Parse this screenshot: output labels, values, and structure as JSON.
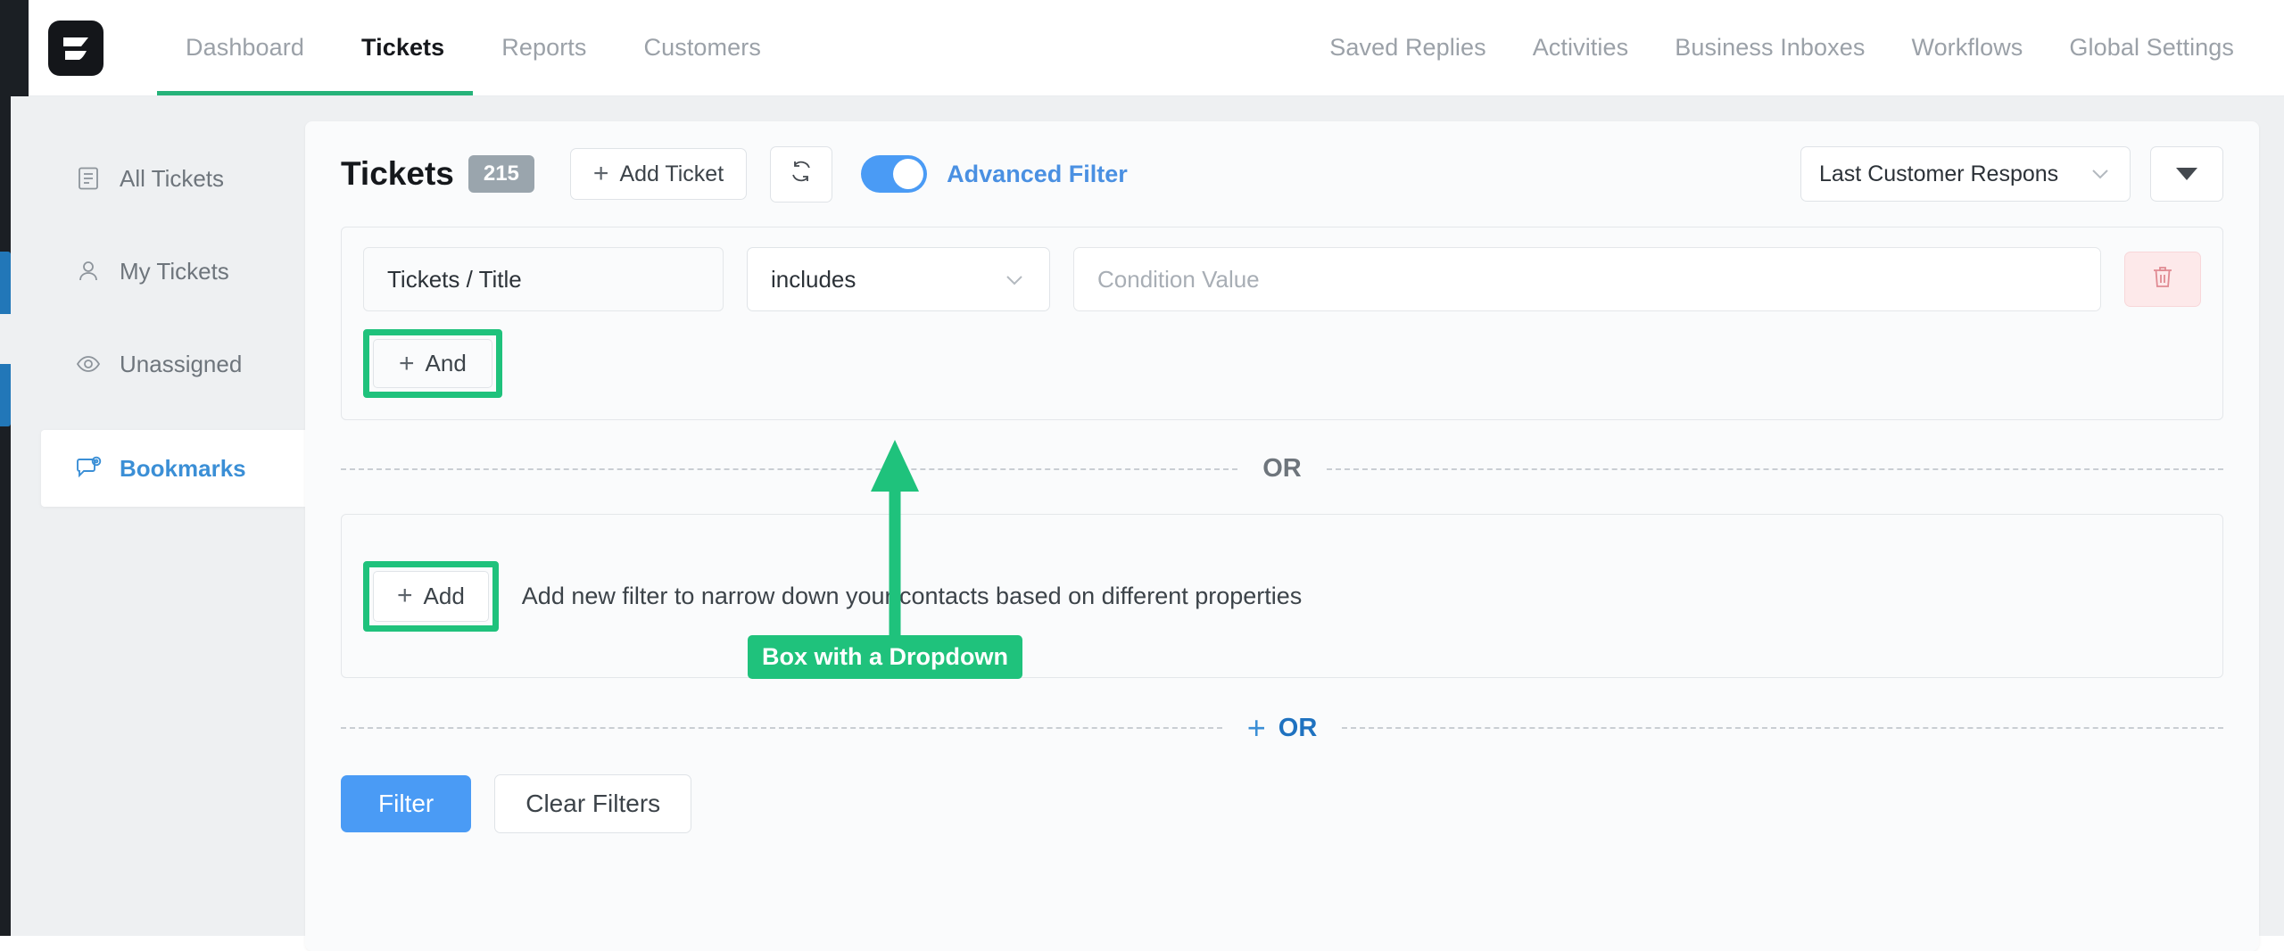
{
  "app": {
    "logo_icon": "flag-logo-icon"
  },
  "nav": {
    "left_items": [
      {
        "label": "Dashboard",
        "active": false
      },
      {
        "label": "Tickets",
        "active": true
      },
      {
        "label": "Reports",
        "active": false
      },
      {
        "label": "Customers",
        "active": false
      }
    ],
    "right_items": [
      {
        "label": "Saved Replies"
      },
      {
        "label": "Activities"
      },
      {
        "label": "Business Inboxes"
      },
      {
        "label": "Workflows"
      },
      {
        "label": "Global Settings"
      }
    ],
    "active_underline_color": "#26b37a"
  },
  "sidebar": {
    "items": [
      {
        "label": "All Tickets",
        "icon": "list-document-icon",
        "active": false
      },
      {
        "label": "My Tickets",
        "icon": "user-icon",
        "active": false
      },
      {
        "label": "Unassigned",
        "icon": "eye-icon",
        "active": false
      },
      {
        "label": "Bookmarks",
        "icon": "comment-at-icon",
        "active": true
      }
    ],
    "active_color": "#3b8fd6"
  },
  "toolbar": {
    "title": "Tickets",
    "count": "215",
    "add_ticket_label": "Add Ticket",
    "refresh_icon": "refresh-icon",
    "advanced_filter_label": "Advanced Filter",
    "advanced_filter_on": true,
    "sort_select_value": "Last Customer Respons",
    "sort_caret_icon": "triangle-down-icon",
    "toggle_color": "#4a9bf5",
    "link_color": "#4a90e2"
  },
  "filter": {
    "condition": {
      "field_label": "Tickets / Title",
      "operator": "includes",
      "operator_chevron_icon": "chevron-down-icon",
      "value_placeholder": "Condition Value",
      "delete_icon": "trash-icon"
    },
    "and_button_label": "And",
    "or_divider_label": "OR",
    "add_button_label": "Add",
    "add_description": "Add new filter to narrow down your contacts based on different properties",
    "or_add_label": "OR",
    "filter_button_label": "Filter",
    "clear_button_label": "Clear Filters",
    "highlight_color": "#1fc27c"
  },
  "annotation": {
    "label": "Box with a Dropdown",
    "arrow_color": "#1fc27c",
    "label_bg": "#1fc27c",
    "label_fg": "#ffffff"
  }
}
